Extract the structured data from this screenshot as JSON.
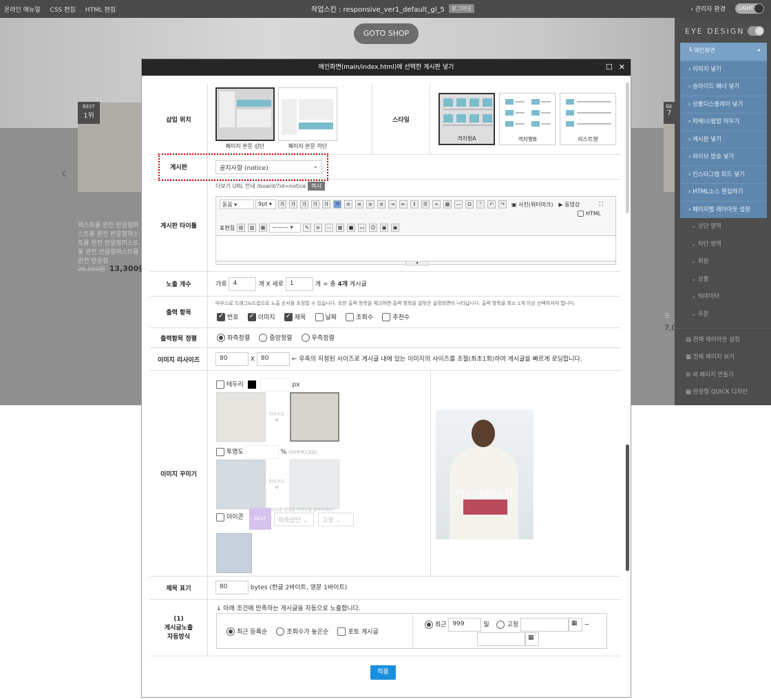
{
  "topbar": {
    "left_links": [
      "온라인 매뉴얼",
      "CSS 편집",
      "HTML 편집"
    ],
    "skin_title": "작업스킨 : responsive_ver1_default_gl_5",
    "logout": "로그아웃",
    "admin_env": "관리자 환경",
    "mode": "LIGHT"
  },
  "site": {
    "goto_shop": "GOTO SHOP",
    "best1": {
      "tag": "BEST",
      "rank": "1위"
    },
    "best7": {
      "tag": "BE",
      "rank": "7"
    },
    "product_text": "퍼스트몰 완전 반응형퍼스트몰 완전 반응형퍼스트몰 완전 반응형퍼스트몰 완전 반응형퍼스트몰 완전 반응형",
    "price_old": "26,000원",
    "price_new": "13,300원",
    "price_right": "7,0",
    "prod_right": "오"
  },
  "sidebar": {
    "brand": "EYE DESIGN",
    "main_item": "메인화면",
    "blue_items": [
      "이미지 넣기",
      "슬라이드 배너 넣기",
      "상품디스플레이 넣기",
      "띠배너/팝업 띄우기",
      "게시판 넣기",
      "라이브 방송 넣기",
      "인스타그램 피드 넣기",
      "HTML소스 편집하기",
      "페이지별 레이아웃 설정"
    ],
    "gray_items": [
      "상단 영역",
      "하단 영역",
      "회원",
      "상품",
      "빅데이터",
      "주문"
    ],
    "bottom_items": [
      "전체 레이아웃 설정",
      "전체 페이지 보기",
      "새 페이지 만들기",
      "반응형 QUICK 디자인"
    ]
  },
  "modal": {
    "title": "메인화면(main/index.html)에 선택한 게시판 넣기",
    "insert_position": {
      "label": "삽입 위치",
      "opt1": "페이지 본문 상단",
      "opt2": "페이지 본문 하단"
    },
    "style": {
      "label": "스타일",
      "opt1": "격자형A",
      "opt2": "격자형B",
      "opt3": "리스트형"
    },
    "board": {
      "label": "게시판",
      "selected": "공지사항 (notice)",
      "url_hint": "더보기 URL 안내 /board/?id=notice",
      "copy": "복사"
    },
    "board_title": {
      "label": "게시판 타이틀",
      "font": "돋움",
      "size": "9pt",
      "photo": "사진(워터마크)",
      "video": "동영상",
      "html": "HTML",
      "table_edit": "표편집"
    },
    "count": {
      "label": "노출 개수",
      "prefix": "가로",
      "cols": "4",
      "mid": "개 X 세로",
      "rows": "1",
      "suffix": "개 = 총",
      "total": "4개",
      "tail": "게시글"
    },
    "output": {
      "label": "출력 항목",
      "desc": "마우스로 드래그&드랍으로 노출 순서를 조정할 수 있습니다. 또한 출력 항목을 체크하면 출력 항목을 알맞은 설정화면이 나타납니다. 출력 항목을 최소 1개 이상 선택하셔야 합니다.",
      "items": [
        "번호",
        "이미지",
        "제목",
        "날짜",
        "조회수",
        "추천수"
      ]
    },
    "align": {
      "label": "출력항목 정렬",
      "opt1": "좌측정렬",
      "opt2": "중앙정렬",
      "opt3": "우측정렬"
    },
    "resize": {
      "label": "이미지 리사이즈",
      "w": "80",
      "x": "X",
      "h": "80",
      "desc": "← 우측의 지정된 사이즈로 게시글 내에 있는 이미지의 사이즈를 조절(최초1회)하여 게시글을 빠르게 로딩합니다."
    },
    "decorate": {
      "label": "이미지 꾸미기",
      "border": "테두리",
      "px": "px",
      "mouseover": "마우스오버",
      "opacity": "투명도",
      "pct": "%",
      "opacity_hint": "(0%투명도없음)",
      "icon": "아이콘",
      "best": "BEST",
      "icon_hint": "아이콘 변경을 아이콘을 클릭하세요!",
      "icon_pos": "좌측상단",
      "icon_fix": "고정",
      "watermark": "firstmall"
    },
    "subject": {
      "label": "제목 표기",
      "value": "80",
      "desc": "bytes (한글 2바이트, 영문 1바이트)"
    },
    "auto": {
      "label": "(1)\n게시글노출\n자동방식",
      "hint": "↓ 아래 조건에 만족하는 게시글을 자동으로 노출합니다.",
      "opt1": "최근 등록순",
      "opt2": "조회수가 높은순",
      "photo": "포토 게시글",
      "recent": "최근",
      "days": "999",
      "day_unit": "일",
      "fixed": "고정",
      "tilde": "~"
    },
    "apply": "적용"
  }
}
